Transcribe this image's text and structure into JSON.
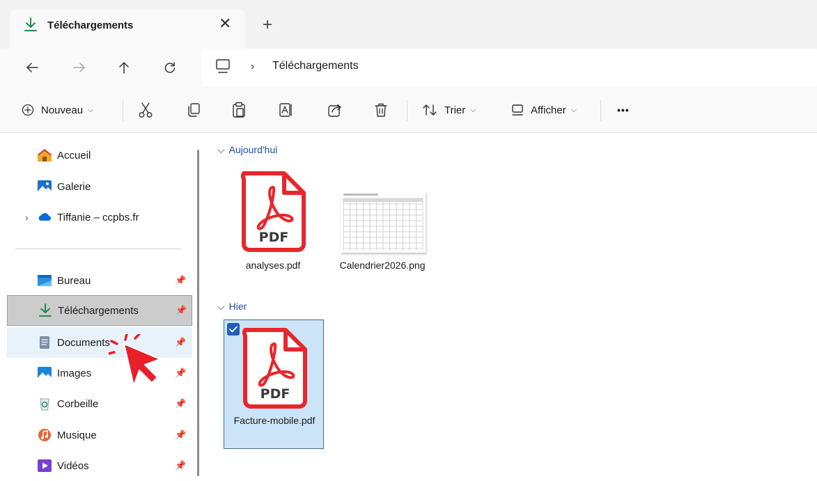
{
  "window": {
    "tab": {
      "label": "Téléchargements",
      "close_glyph": "✕"
    },
    "new_tab_glyph": "+"
  },
  "navigation": {
    "back_icon": "arrow-left-icon",
    "forward_icon": "arrow-right-icon",
    "up_icon": "arrow-up-icon",
    "refresh_icon": "refresh-icon",
    "address": {
      "root_icon": "computer-icon",
      "separator": "›",
      "crumb": "Téléchargements"
    }
  },
  "toolbar": {
    "new_label": "Nouveau",
    "sort_label": "Trier",
    "view_label": "Afficher",
    "more_glyph": "•••",
    "caret_glyph": "⌵"
  },
  "sidebar": {
    "items": [
      {
        "label": "Accueil",
        "icon": "home-icon"
      },
      {
        "label": "Galerie",
        "icon": "gallery-icon"
      },
      {
        "label": "Tiffanie – ccpbs.fr",
        "icon": "onedrive-icon",
        "expander": "›"
      },
      {
        "label": "Bureau",
        "icon": "desktop-icon",
        "pinned": true
      },
      {
        "label": "Téléchargements",
        "icon": "download-icon",
        "pinned": true,
        "selected": true
      },
      {
        "label": "Documents",
        "icon": "documents-icon",
        "pinned": true
      },
      {
        "label": "Images",
        "icon": "pictures-icon",
        "pinned": true
      },
      {
        "label": "Corbeille",
        "icon": "recycle-bin-icon",
        "pinned": true
      },
      {
        "label": "Musique",
        "icon": "music-icon",
        "pinned": true
      },
      {
        "label": "Vidéos",
        "icon": "videos-icon",
        "pinned": true
      }
    ]
  },
  "content": {
    "groups": [
      {
        "header": "Aujourd'hui",
        "files": [
          {
            "name": "analyses.pdf",
            "type": "pdf"
          },
          {
            "name": "Calendrier2026.png",
            "type": "png"
          }
        ]
      },
      {
        "header": "Hier",
        "files": [
          {
            "name": "Facture-mobile.pdf",
            "type": "pdf",
            "selected": true
          }
        ]
      }
    ],
    "pdf_badge": "PDF"
  },
  "colors": {
    "accent": "#1f5fb4",
    "download_green": "#1e8a4a",
    "pdf_red": "#e8262b",
    "selection": "#cce4f7",
    "cursor_red": "#e8202a"
  }
}
